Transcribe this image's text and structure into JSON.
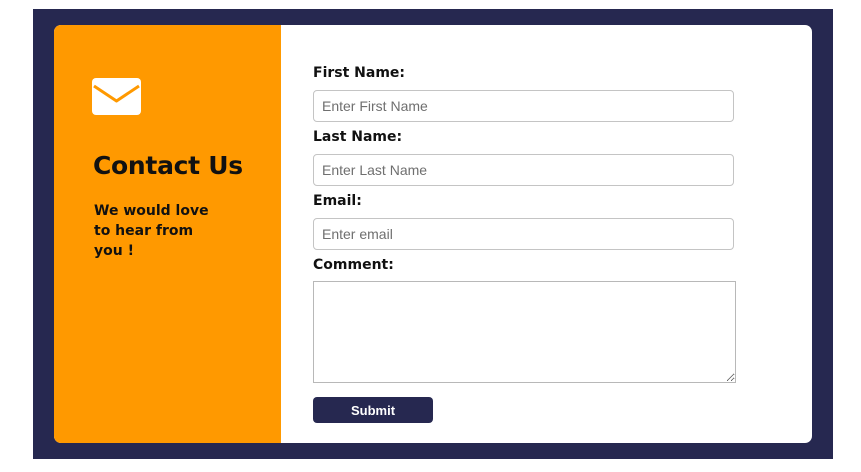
{
  "colors": {
    "frame": "#262850",
    "accent": "#ff9900",
    "button": "#262850"
  },
  "sidebar": {
    "icon": "envelope-icon",
    "title": "Contact Us",
    "text": "We would love to hear from you !"
  },
  "form": {
    "first_name": {
      "label": "First Name:",
      "placeholder": "Enter First Name",
      "value": ""
    },
    "last_name": {
      "label": "Last Name:",
      "placeholder": "Enter Last Name",
      "value": ""
    },
    "email": {
      "label": "Email:",
      "placeholder": "Enter email",
      "value": ""
    },
    "comment": {
      "label": "Comment:",
      "value": ""
    },
    "submit_label": "Submit"
  }
}
